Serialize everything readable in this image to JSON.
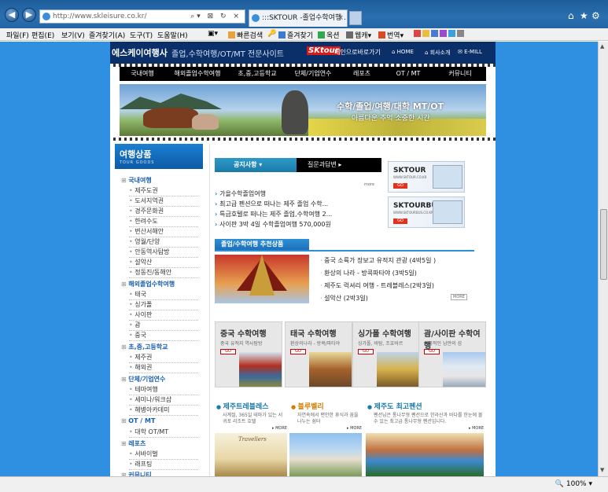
{
  "browser": {
    "url": "http://www.skleisure.co.kr/",
    "tab_title": ":::SKTOUR -졸업수학여행 ...",
    "menu": [
      "파일(F)",
      "편집(E)",
      "보기(V)",
      "즐겨찾기(A)",
      "도구(T)",
      "도움말(H)"
    ],
    "toolbar": {
      "quick_search": "빠른검색",
      "favorites": "즐겨찾기",
      "translate_label": "옥션",
      "web": "웹캐",
      "translate": "번역"
    },
    "zoom": "100%"
  },
  "site": {
    "logo": "에스케이여행사",
    "tagline": "졸업,수학여행/OT/MT 전문사이트",
    "sk_badge": "SKtour",
    "sk_shortcut": "페인으로바로가기",
    "header_links": [
      "HOME",
      "회사소개",
      "E-MILL"
    ],
    "nav": [
      "국내여행",
      "해외졸업수학여행",
      "초,중,고등학교",
      "단체/기업연수",
      "레포츠",
      "OT / MT",
      "커뮤니티"
    ],
    "banner_title": "수학/졸업/여행/대학 MT/OT",
    "banner_sub": "아름다운 추억 소중한 시간"
  },
  "sidebar": {
    "title": "여행상품",
    "subtitle": "TOUR GOODS",
    "categories": [
      {
        "label": "국내여행",
        "items": [
          "제주도권",
          "도서지역권",
          "경주문화권",
          "한려수도",
          "변산서해안",
          "영월/단양",
          "안동역사탐방",
          "설악산",
          "정동진/동해안"
        ]
      },
      {
        "label": "해외졸업수학여행",
        "items": [
          "태국",
          "싱가폴",
          "사이판",
          "괌",
          "중국"
        ]
      },
      {
        "label": "초,중,고등학교",
        "items": [
          "제주권",
          "해외권"
        ]
      },
      {
        "label": "단체/기업연수",
        "items": [
          "테마여행",
          "세미나/워크샵",
          "해병아카데미"
        ]
      },
      {
        "label": "OT / MT",
        "items": [
          "대학 OT/MT"
        ]
      },
      {
        "label": "레포츠",
        "items": [
          "서바이벌",
          "래프팅"
        ]
      },
      {
        "label": "커뮤니티",
        "items": []
      }
    ]
  },
  "notice": {
    "tab1": "공지사항",
    "tab2": "질문과답변",
    "more": "more",
    "items": [
      "가을수학졸업여행",
      "최고급 펜션으로 떠나는 제주 졸업 수학...",
      "특급호텔로 떠나는 제주 졸업,수학여행 2...",
      "사이판 3박 4일 수학졸업여행 570,000원"
    ]
  },
  "side_banners": [
    {
      "title": "SKTOUR",
      "url": "WWW.SKTOUR.CO.KR",
      "go": "GO"
    },
    {
      "title": "SKTOURBUS",
      "url": "WWW.SKTOURBUS.CO.KR",
      "go": "GO"
    }
  ],
  "recommend": {
    "title": "졸업/수학여행 추천상품",
    "items": [
      "중국 소륙가 장보고 유적지 관광 (4박5일 )",
      "환상의 나라 - 방콕파타야 (3박5일)",
      "제주도 럭셔리 여행 - 트레블레스(2박3일)",
      "설악산 (2박3일)"
    ],
    "more": "MORE"
  },
  "packages": [
    {
      "title": "중국 수학여행",
      "desc": "중국 유적지 역사탐방",
      "go": "GO"
    },
    {
      "title": "태국 수학여행",
      "desc": "환상의나라 - 방콕/파타야",
      "go": "GO"
    },
    {
      "title": "싱가폴 수학여행",
      "desc": "싱가폴, 바탐, 조호바르",
      "go": "GO"
    },
    {
      "title": "괌/사이판 수학여행",
      "desc": "이국적인 남만의 섬",
      "go": "GO"
    }
  ],
  "pensions": [
    {
      "title": "제주트레블레스",
      "desc": "사계절, 365일 테마가 있는 서귀포 리조트 호텔",
      "more": "MORE",
      "pic_label": "Travellers"
    },
    {
      "title": "블루벨리",
      "desc": "자연속에서 편안한 휴식과 꿈을 나누는 쉼터",
      "more": "MORE"
    },
    {
      "title": "제주도 최고펜션",
      "desc": "펜션님은 통나무형 펜션으로 한라산과 바다를 한눈에 볼 수 있는 최고급 통나무형 펜션입니다.",
      "more": "MORE"
    }
  ],
  "colors": {
    "site_bg": "#2f8fe0",
    "header": "#0b2f68",
    "accent": "#1b5fb0"
  }
}
